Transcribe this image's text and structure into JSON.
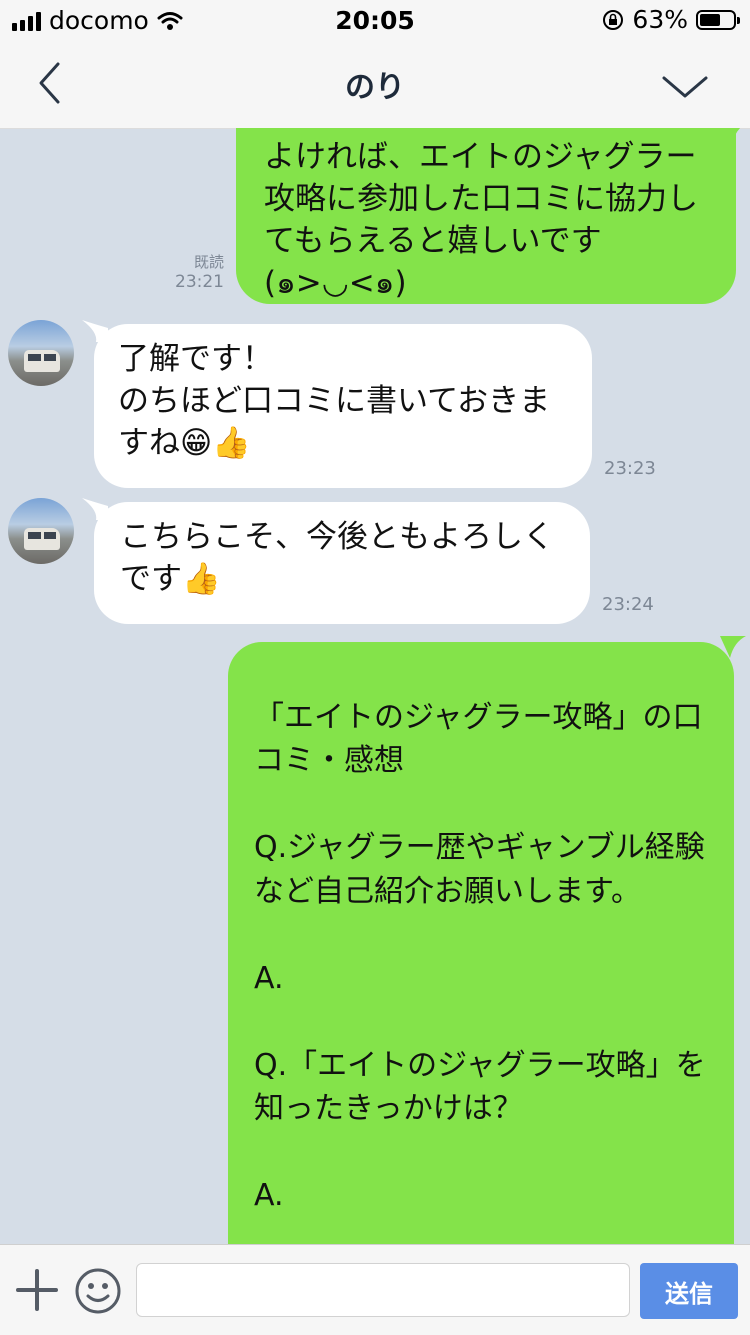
{
  "status_bar": {
    "carrier": "docomo",
    "time": "20:05",
    "battery": "63%",
    "battery_level": 0.63
  },
  "header": {
    "title": "のり"
  },
  "messages": [
    {
      "direction": "outgoing",
      "text": "よければ、エイトのジャグラー攻略に参加した口コミに協力してもらえると嬉しいです\n(๑>◡<๑)",
      "read_label": "既読",
      "time": "23:21"
    },
    {
      "direction": "incoming",
      "text": "了解です！\nのちほど口コミに書いておきますね😁👍",
      "time": "23:23"
    },
    {
      "direction": "incoming",
      "text": "こちらこそ、今後ともよろしくです👍",
      "time": "23:24"
    },
    {
      "direction": "outgoing",
      "text": "\n「エイトのジャグラー攻略」の口コミ・感想\n\nQ.ジャグラー歴やギャンブル経験など自己紹介お願いします。\n\nA.\n\nQ.「エイトのジャグラー攻略」を知ったきっかけは？\n\nA.\n\nQ.「エイトのジャグラー攻略」"
    }
  ],
  "input_bar": {
    "placeholder": "",
    "send_label": "送信"
  },
  "icons": {
    "back": "chevron-left-icon",
    "menu": "chevron-down-icon",
    "plus": "plus-icon",
    "emoji": "smiley-icon"
  },
  "colors": {
    "outgoing_bubble": "#84e34a",
    "incoming_bubble": "#ffffff",
    "chat_background": "#d5dde7",
    "send_button": "#5a8ee6"
  }
}
